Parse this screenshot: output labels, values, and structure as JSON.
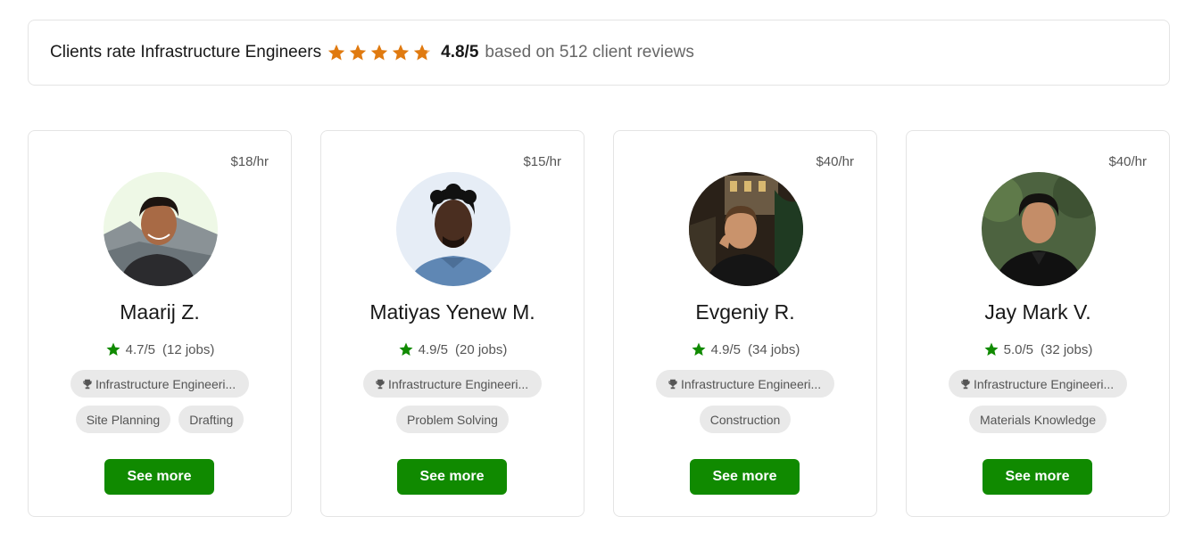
{
  "banner": {
    "text": "Clients rate Infrastructure Engineers",
    "star_count": 5,
    "star_color": "#e07a10",
    "score": "4.8/5",
    "reviews": "based on 512 client reviews"
  },
  "accent_color": "#108a00",
  "cards": [
    {
      "rate": "$18/hr",
      "name": "Maarij Z.",
      "rating": "4.7/5",
      "jobs": "(12 jobs)",
      "main_tag": "Infrastructure Engineeri...",
      "tags": [
        "Site Planning",
        "Drafting"
      ],
      "button": "See more"
    },
    {
      "rate": "$15/hr",
      "name": "Matiyas Yenew M.",
      "rating": "4.9/5",
      "jobs": "(20 jobs)",
      "main_tag": "Infrastructure Engineeri...",
      "tags": [
        "Problem Solving"
      ],
      "button": "See more"
    },
    {
      "rate": "$40/hr",
      "name": "Evgeniy R.",
      "rating": "4.9/5",
      "jobs": "(34 jobs)",
      "main_tag": "Infrastructure Engineeri...",
      "tags": [
        "Construction"
      ],
      "button": "See more"
    },
    {
      "rate": "$40/hr",
      "name": "Jay Mark V.",
      "rating": "5.0/5",
      "jobs": "(32 jobs)",
      "main_tag": "Infrastructure Engineeri...",
      "tags": [
        "Materials Knowledge"
      ],
      "button": "See more"
    }
  ]
}
